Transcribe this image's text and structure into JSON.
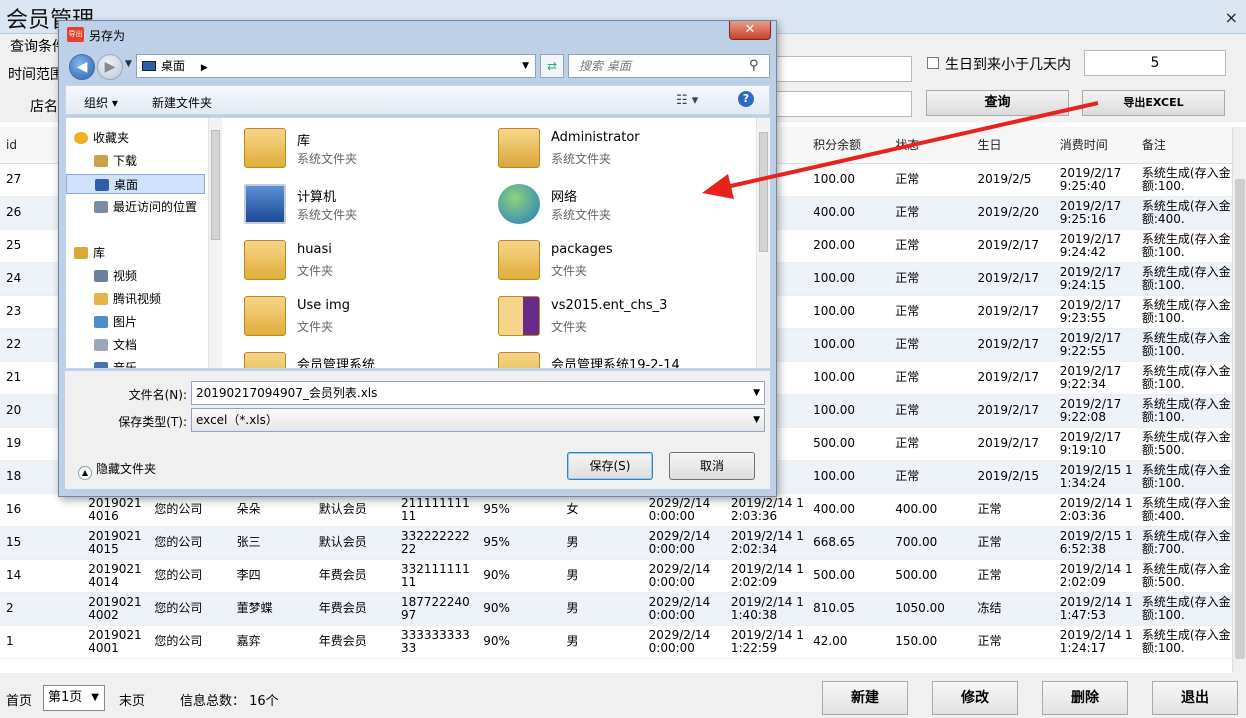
{
  "window": {
    "title": "会员管理",
    "close": "×"
  },
  "query": {
    "group_label": "查询条件",
    "time_range_label": "时间范围",
    "store_label": "店名",
    "birthday_label": "生日到来小于几天内",
    "birthday_days": "5",
    "search_btn": "查询",
    "export_btn": "导出EXCEL"
  },
  "grid": {
    "headers": [
      "id",
      "",
      "",
      "",
      "",
      "",
      "",
      "",
      "",
      "余金额",
      "积分余额",
      "状态",
      "生日",
      "消费时间",
      "备注"
    ],
    "rows": [
      [
        "27",
        "",
        "",
        "",
        "",
        "",
        "",
        "",
        "",
        ".00",
        "100.00",
        "正常",
        "2019/2/5",
        "2019/2/17 9:25:40",
        "系统生成(存入金额:100."
      ],
      [
        "26",
        "",
        "",
        "",
        "",
        "",
        "",
        "",
        "",
        ".00",
        "400.00",
        "正常",
        "2019/2/20",
        "2019/2/17 9:25:16",
        "系统生成(存入金额:400."
      ],
      [
        "25",
        "",
        "",
        "",
        "",
        "",
        "",
        "",
        "",
        ".00",
        "200.00",
        "正常",
        "2019/2/17",
        "2019/2/17 9:24:42",
        "系统生成(存入金额:100."
      ],
      [
        "24",
        "",
        "",
        "",
        "",
        "",
        "",
        "",
        "",
        ".00",
        "100.00",
        "正常",
        "2019/2/17",
        "2019/2/17 9:24:15",
        "系统生成(存入金额:100."
      ],
      [
        "23",
        "",
        "",
        "",
        "",
        "",
        "",
        "",
        "",
        ".00",
        "100.00",
        "正常",
        "2019/2/17",
        "2019/2/17 9:23:55",
        "系统生成(存入金额:100."
      ],
      [
        "22",
        "",
        "",
        "",
        "",
        "",
        "",
        "",
        "",
        ".00",
        "100.00",
        "正常",
        "2019/2/17",
        "2019/2/17 9:22:55",
        "系统生成(存入金额:100."
      ],
      [
        "21",
        "",
        "",
        "",
        "",
        "",
        "",
        "",
        "",
        ".00",
        "100.00",
        "正常",
        "2019/2/17",
        "2019/2/17 9:22:34",
        "系统生成(存入金额:100."
      ],
      [
        "20",
        "",
        "",
        "",
        "",
        "",
        "",
        "",
        "",
        ".00",
        "100.00",
        "正常",
        "2019/2/17",
        "2019/2/17 9:22:08",
        "系统生成(存入金额:100."
      ],
      [
        "19",
        "",
        "",
        "",
        "",
        "",
        "",
        "",
        "",
        ".00",
        "500.00",
        "正常",
        "2019/2/17",
        "2019/2/17 9:19:10",
        "系统生成(存入金额:500."
      ],
      [
        "18",
        "",
        "",
        "",
        "",
        "",
        "",
        "",
        "",
        ".00",
        "100.00",
        "正常",
        "2019/2/15",
        "2019/2/15 11:34:24",
        "系统生成(存入金额:100."
      ],
      [
        "16",
        "2019021 4016",
        "您的公司",
        "朵朵",
        "默认会员",
        "211111111 11",
        "95%",
        "女",
        "2029/2/14 0:00:00",
        "2019/2/14 12:03:36",
        "400.00",
        "400.00",
        "正常",
        "2019/2/14",
        "2019/2/14 12:03:36",
        "系统生成(存入金额:400."
      ],
      [
        "15",
        "2019021 4015",
        "您的公司",
        "张三",
        "默认会员",
        "332222222 22",
        "95%",
        "男",
        "2029/2/14 0:00:00",
        "2019/2/14 12:02:34",
        "668.65",
        "700.00",
        "正常",
        "2019/2/14",
        "2019/2/15 16:52:38",
        "系统生成(存入金额:700."
      ],
      [
        "14",
        "2019021 4014",
        "您的公司",
        "李四",
        "年费会员",
        "332111111 11",
        "90%",
        "男",
        "2029/2/14 0:00:00",
        "2019/2/14 12:02:09",
        "500.00",
        "500.00",
        "正常",
        "2019/2/14",
        "2019/2/14 12:02:09",
        "系统生成(存入金额:500."
      ],
      [
        "2",
        "2019021 4002",
        "您的公司",
        "董梦蝶",
        "年费会员",
        "187722240 97",
        "90%",
        "男",
        "2029/2/14 0:00:00",
        "2019/2/14 11:40:38",
        "810.05",
        "1050.00",
        "冻结",
        "2019/2/14",
        "2019/2/14 11:47:53",
        "系统生成(存入金额:100."
      ],
      [
        "1",
        "2019021 4001",
        "您的公司",
        "嘉弈",
        "年费会员",
        "333333333 33",
        "90%",
        "男",
        "2029/2/14 0:00:00",
        "2019/2/14 11:22:59",
        "42.00",
        "150.00",
        "正常",
        "2019/2/14",
        "2019/2/14 11:24:17",
        "系统生成(存入金额:100."
      ]
    ]
  },
  "footer": {
    "first": "首页",
    "page": "第1页",
    "last": "末页",
    "total": "信息总数： 16个",
    "new_btn": "新建",
    "edit_btn": "修改",
    "delete_btn": "删除",
    "exit_btn": "退出"
  },
  "dialog": {
    "title": "另存为",
    "app_badge": "导出",
    "close": "✕",
    "address": "桌面",
    "search_placeholder": "搜索 桌面",
    "organize": "组织 ▾",
    "new_folder": "新建文件夹",
    "tree": [
      {
        "label": "收藏夹",
        "icon": "star-icon"
      },
      {
        "label": "下载",
        "icon": "download-folder-icon"
      },
      {
        "label": "桌面",
        "icon": "desktop-icon"
      },
      {
        "label": "最近访问的位置",
        "icon": "recent-places-icon"
      },
      {
        "label": "库",
        "icon": "library-icon"
      },
      {
        "label": "视频",
        "icon": "video-icon"
      },
      {
        "label": "腾讯视频",
        "icon": "folder-icon"
      },
      {
        "label": "图片",
        "icon": "pictures-icon"
      },
      {
        "label": "文档",
        "icon": "documents-icon"
      },
      {
        "label": "音乐",
        "icon": "music-icon"
      }
    ],
    "files": [
      {
        "name": "库",
        "type": "系统文件夹"
      },
      {
        "name": "Administrator",
        "type": "系统文件夹"
      },
      {
        "name": "计算机",
        "type": "系统文件夹"
      },
      {
        "name": "网络",
        "type": "系统文件夹"
      },
      {
        "name": "huasi",
        "type": "文件夹"
      },
      {
        "name": "packages",
        "type": "文件夹"
      },
      {
        "name": "Use img",
        "type": "文件夹"
      },
      {
        "name": "vs2015.ent_chs_3",
        "type": "文件夹"
      },
      {
        "name": "会员管理系统",
        "type": ""
      },
      {
        "name": "会员管理系统19-2-14",
        "type": ""
      }
    ],
    "filename_label": "文件名(N):",
    "filename": "20190217094907_会员列表.xls",
    "filetype_label": "保存类型(T):",
    "filetype": "excel（*.xls）",
    "hide_folders": "隐藏文件夹",
    "save_btn": "保存(S)",
    "cancel_btn": "取消"
  },
  "colors": {
    "arrow": "#e8231d",
    "row_alt": "#eef3fa",
    "dialog_frame": "#bcd0e8"
  }
}
